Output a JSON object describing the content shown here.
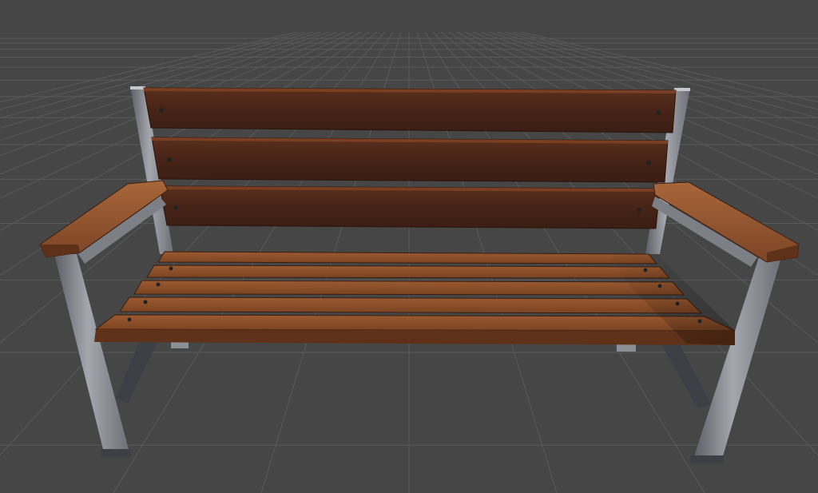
{
  "scene": {
    "object": "park-bench",
    "view": "perspective-3d-viewport",
    "background_color": "#464646",
    "grid_color": "#5a5a5a",
    "wood_color": "#8a4f2a",
    "wood_dark_color": "#4a2618",
    "metal_color": "#8c9096",
    "metal_dark_color": "#3c3f44"
  }
}
